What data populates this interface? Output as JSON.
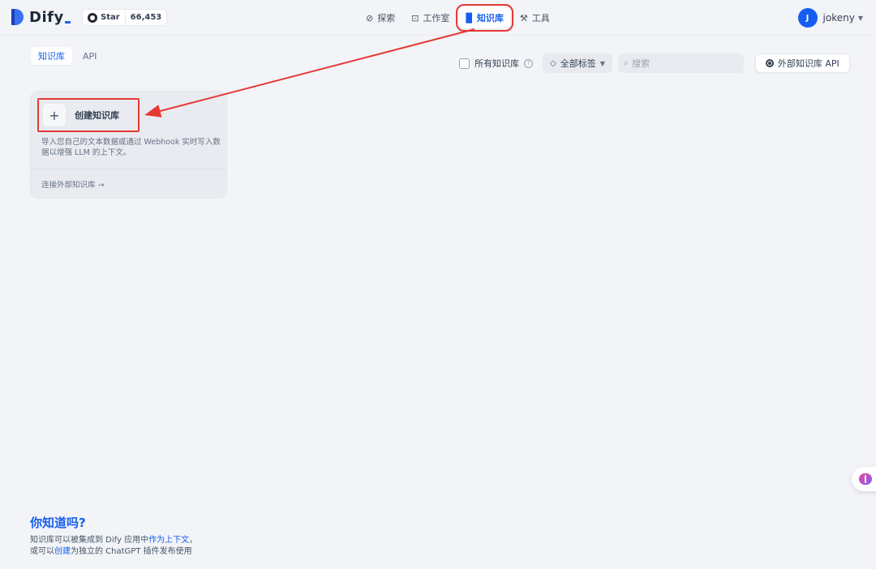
{
  "header": {
    "logo_text": "Dify",
    "star": {
      "label": "Star",
      "count": "66,453"
    },
    "nav": [
      {
        "label": "探索",
        "icon": "compass-icon"
      },
      {
        "label": "工作室",
        "icon": "robot-icon"
      },
      {
        "label": "知识库",
        "icon": "book-icon",
        "active": true
      },
      {
        "label": "工具",
        "icon": "hammer-icon"
      }
    ],
    "user": {
      "initial": "J",
      "name": "jokeny"
    }
  },
  "subtabs": [
    {
      "label": "知识库",
      "active": true
    },
    {
      "label": "API",
      "active": false
    }
  ],
  "toolbar": {
    "all_kb_label": "所有知识库",
    "tag_filter_label": "全部标签",
    "search_placeholder": "搜索",
    "ext_api_label": "外部知识库 API"
  },
  "create_card": {
    "title": "创建知识库",
    "description": "导入您自己的文本数据或通过 Webhook 实时写入数据以增强 LLM 的上下文。",
    "external_link": "连接外部知识库 →"
  },
  "tips": {
    "title": "你知道吗?",
    "line1_pre": "知识库可以被集成到 Dify 应用中",
    "line1_link": "作为上下文",
    "line1_post": "，",
    "line2_pre": "或可以",
    "line2_link": "创建",
    "line2_post": "为独立的 ChatGPT 插件发布使用"
  },
  "colors": {
    "accent": "#155eef",
    "highlight": "#e53935",
    "background": "#f2f4f7"
  }
}
